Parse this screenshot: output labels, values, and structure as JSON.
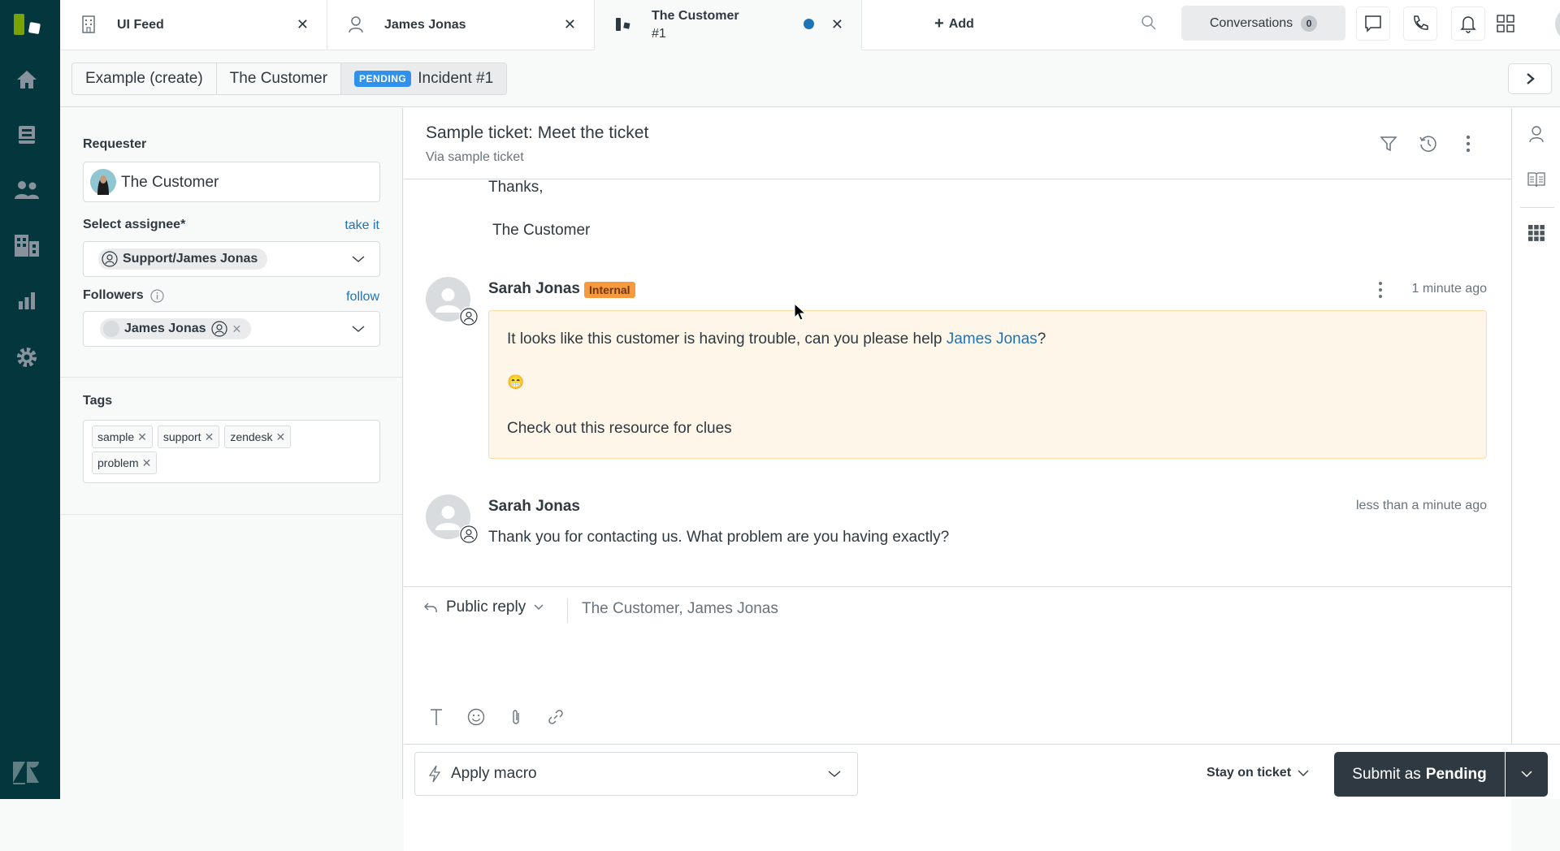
{
  "nav": {
    "items": [
      {
        "name": "home",
        "icon": "home-icon"
      },
      {
        "name": "views",
        "icon": "inbox-icon"
      },
      {
        "name": "customers",
        "icon": "people-icon"
      },
      {
        "name": "organizations",
        "icon": "building-icon"
      },
      {
        "name": "reporting",
        "icon": "bar-chart-icon"
      },
      {
        "name": "admin",
        "icon": "gear-icon"
      }
    ]
  },
  "tabs": [
    {
      "label": "UI Feed",
      "icon": "building-icon"
    },
    {
      "label": "James Jonas",
      "icon": "user-icon"
    },
    {
      "label": "The Customer",
      "label2": "#1",
      "icon": "zendesk-icon",
      "active": true,
      "unsaved": true
    }
  ],
  "topbar": {
    "add_label": "Add",
    "conversations_label": "Conversations",
    "conversations_count": "0"
  },
  "breadcrumb": {
    "items": [
      "Example (create)",
      "The Customer"
    ],
    "status_badge": "PENDING",
    "current": "Incident #1"
  },
  "sidebar": {
    "requester_label": "Requester",
    "requester_value": "The Customer",
    "assignee_label": "Select assignee*",
    "assignee_link": "take it",
    "assignee_value": "Support/James Jonas",
    "followers_label": "Followers",
    "followers_link": "follow",
    "followers": [
      "James Jonas"
    ],
    "tags_label": "Tags",
    "tags": [
      "sample",
      "support",
      "zendesk",
      "problem"
    ]
  },
  "ticket": {
    "title": "Sample ticket: Meet the ticket",
    "via": "Via sample ticket"
  },
  "conversation": {
    "prev_message_tail": [
      "Thanks,",
      "The Customer"
    ],
    "messages": [
      {
        "author": "Sarah Jonas",
        "badge": "Internal",
        "time": "1 minute ago",
        "text_before_mention": "It looks like this customer is having trouble, can you please help ",
        "mention": "James Jonas",
        "text_after_mention": "?",
        "emoji": "😁",
        "link": "Check out this resource for clues"
      },
      {
        "author": "Sarah Jonas",
        "time": "less than a minute ago",
        "text": "Thank you for contacting us. What problem are you having exactly?"
      }
    ]
  },
  "reply": {
    "type": "Public reply",
    "recipients": "The Customer, James Jonas"
  },
  "footer": {
    "macro_label": "Apply macro",
    "stay_label": "Stay on ticket",
    "submit_prefix": "Submit as",
    "submit_status": "Pending"
  },
  "colors": {
    "nav_bg": "#03363d",
    "accent_blue": "#1f73b7",
    "internal_note_bg": "#fef6e8",
    "internal_badge": "#f79a3e",
    "submit_bg": "#2f3941"
  }
}
